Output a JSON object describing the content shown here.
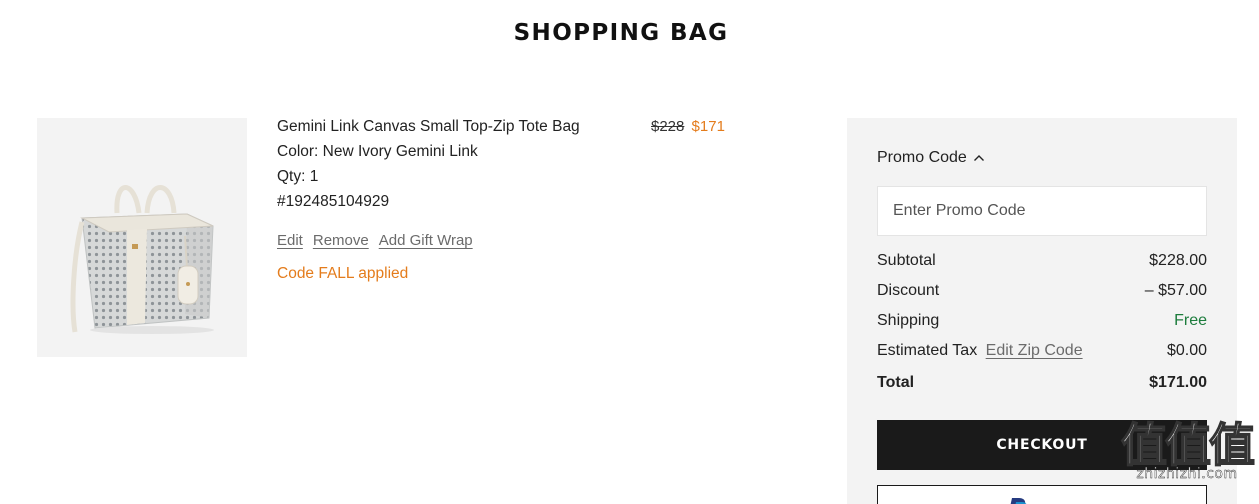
{
  "page": {
    "title": "SHOPPING BAG"
  },
  "item": {
    "name": "Gemini Link Canvas Small Top-Zip Tote Bag",
    "color": "Color: New Ivory Gemini Link",
    "qty": "Qty: 1",
    "sku": "#192485104929",
    "price_original": "$228",
    "price_sale": "$171",
    "actions": {
      "edit": "Edit",
      "remove": "Remove",
      "gift_wrap": "Add Gift Wrap"
    },
    "promo_applied": "Code FALL applied",
    "image_icon": "tote-bag-image"
  },
  "summary": {
    "promo_label": "Promo Code",
    "promo_toggle_icon": "chevron-up-icon",
    "promo_placeholder": "Enter Promo Code",
    "promo_value": "",
    "rows": {
      "subtotal": {
        "label": "Subtotal",
        "value": "$228.00"
      },
      "discount": {
        "label": "Discount",
        "value": "– $57.00"
      },
      "shipping": {
        "label": "Shipping",
        "value": "Free"
      },
      "tax": {
        "label": "Estimated Tax",
        "link": "Edit Zip Code",
        "value": "$0.00"
      },
      "total": {
        "label": "Total",
        "value": "$171.00"
      }
    },
    "checkout_label": "CHECKOUT",
    "paypal_icon": "paypal-logo"
  },
  "watermark": {
    "glyphs": "值值值",
    "text": "zhizhizhi.com"
  },
  "colors": {
    "accent_orange": "#e47c1c",
    "free_green": "#1c7c3c",
    "panel_bg": "#f3f3f3",
    "button_bg": "#1a1a1a"
  }
}
